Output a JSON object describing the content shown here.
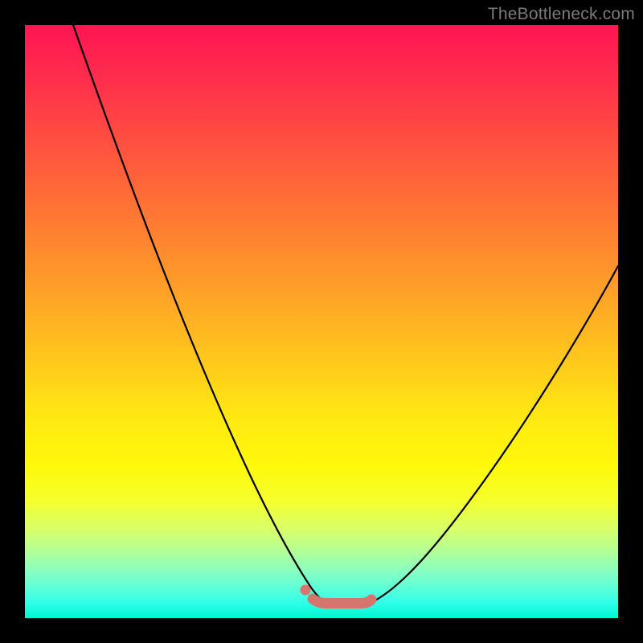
{
  "watermark": "TheBottleneck.com",
  "colors": {
    "frame": "#000000",
    "curve": "#000000",
    "marker": "#d6756d"
  },
  "chart_data": {
    "type": "line",
    "title": "",
    "xlabel": "",
    "ylabel": "",
    "xlim": [
      0,
      100
    ],
    "ylim": [
      0,
      100
    ],
    "grid": false,
    "legend": false,
    "series": [
      {
        "name": "left-curve",
        "x": [
          8.1,
          10,
          14,
          18,
          22,
          26,
          30,
          34,
          38,
          41,
          44,
          46,
          47.5,
          49,
          50
        ],
        "y": [
          100,
          94,
          82,
          70,
          59,
          49,
          39,
          30,
          21,
          14,
          9,
          5.2,
          3.5,
          2.5,
          2.5
        ]
      },
      {
        "name": "right-curve",
        "x": [
          58,
          60,
          63,
          66,
          70,
          74,
          78,
          82,
          86,
          90,
          94,
          98,
          100
        ],
        "y": [
          2.5,
          4,
          7,
          11,
          17,
          24,
          31,
          38,
          45,
          52,
          59,
          65,
          68
        ]
      },
      {
        "name": "bottom-band",
        "x": [
          49,
          50,
          51,
          52,
          53,
          54,
          55,
          56,
          57,
          58
        ],
        "y": [
          2.6,
          2.5,
          2.5,
          2.5,
          2.5,
          2.5,
          2.5,
          2.5,
          2.5,
          2.6
        ]
      },
      {
        "name": "left-dot",
        "x": [
          47.5
        ],
        "y": [
          4.2
        ]
      }
    ],
    "note": "x and y are percentages of the plot area (0 = left/bottom edge of the gradient square, 100 = right/top edge). Values estimated visually; chart has no axes, ticks, or labels."
  }
}
